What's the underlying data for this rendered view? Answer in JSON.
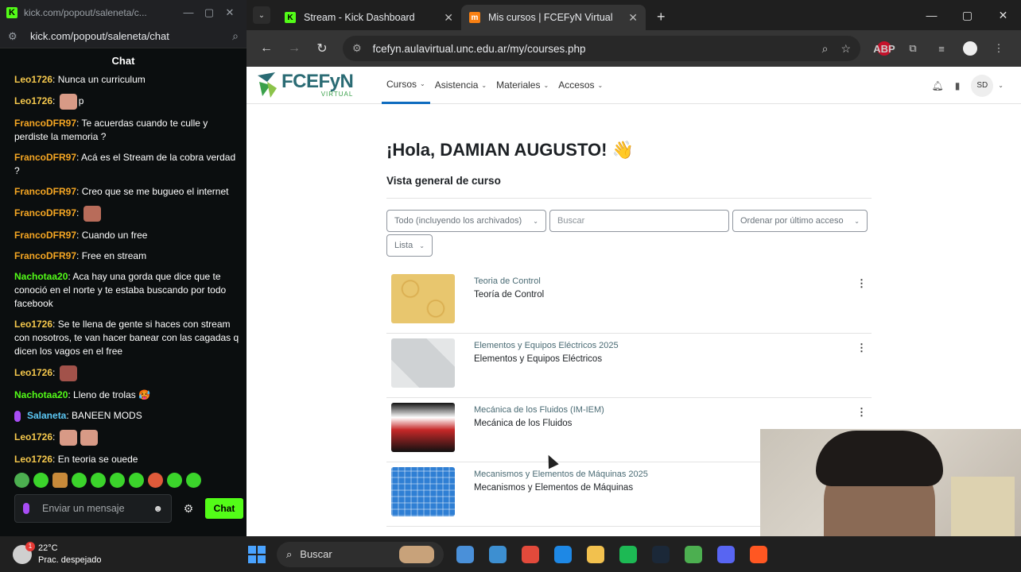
{
  "kick_window": {
    "title": "kick.com/popout/saleneta/c...",
    "url": "kick.com/popout/saleneta/chat",
    "chat_header": "Chat",
    "messages": [
      {
        "user": "Leo1726",
        "text": ": Nunca un curriculum",
        "color": "#f5c84c"
      },
      {
        "user": "Leo1726",
        "text": ": ",
        "tail": "p",
        "color": "#f5c84c",
        "emote": "#d89a86"
      },
      {
        "user": "FrancoDFR97",
        "text": ": Te acuerdas cuando te culle y perdiste la memoria ?",
        "color": "#f5a623"
      },
      {
        "user": "FrancoDFR97",
        "text": ": Acá es el Stream de la cobra verdad ?",
        "color": "#f5a623"
      },
      {
        "user": "FrancoDFR97",
        "text": ": Creo que se me bugueo el internet",
        "color": "#f5a623"
      },
      {
        "user": "FrancoDFR97",
        "text": ": ",
        "color": "#f5a623",
        "emote": "#b86c5a"
      },
      {
        "user": "FrancoDFR97",
        "text": ": Cuando un free",
        "color": "#f5a623"
      },
      {
        "user": "FrancoDFR97",
        "text": ": Free en stream",
        "color": "#f5a623"
      },
      {
        "user": "Nachotaa20",
        "text": ": Aca hay una gorda que dice que te conoció en el norte y te estaba buscando por todo facebook",
        "color": "#53fc18"
      },
      {
        "user": "Leo1726",
        "text": ": Se te llena de gente si haces con stream con nosotros, te van hacer banear con las cagadas q dicen los vagos en el free",
        "color": "#f5c84c"
      },
      {
        "user": "Leo1726",
        "text": ": ",
        "color": "#f5c84c",
        "emote": "#a2524a"
      },
      {
        "user": "Nachotaa20",
        "text": ": Lleno de trolas 🥵",
        "color": "#53fc18"
      },
      {
        "user": "Salaneta",
        "text": ": BANEEN MODS",
        "color": "#5cc8f5",
        "badge": true
      },
      {
        "user": "Leo1726",
        "text": ": ",
        "color": "#f5c84c",
        "emote": "#d89a86",
        "emote2": true
      },
      {
        "user": "Leo1726",
        "text": ": En teoria se ouede",
        "color": "#f5c84c"
      }
    ],
    "input_placeholder": "Enviar un mensaje",
    "chat_button": "Chat"
  },
  "browser": {
    "tabs": [
      {
        "label": "Stream - Kick Dashboard",
        "active": false,
        "fav": "K",
        "fav_color": "#53fc18"
      },
      {
        "label": "Mis cursos | FCEFyN Virtual",
        "active": true,
        "fav": "m",
        "fav_color": "#f98012"
      }
    ],
    "url": "fcefyn.aulavirtual.unc.edu.ar/my/courses.php",
    "abp": "ABP"
  },
  "moodle": {
    "brand_name": "FCEFyN",
    "brand_sub": "VIRTUAL",
    "menu": [
      {
        "label": "Cursos",
        "active": true
      },
      {
        "label": "Asistencia",
        "active": false
      },
      {
        "label": "Materiales",
        "active": false
      },
      {
        "label": "Accesos",
        "active": false
      }
    ],
    "avatar": "SD",
    "greeting": "¡Hola, DAMIAN AUGUSTO! 👋",
    "section_title": "Vista general de curso",
    "filter_grouping": "Todo (incluyendo los archivados)",
    "search_placeholder": "Buscar",
    "sort": "Ordenar por último acceso",
    "view": "Lista",
    "courses": [
      {
        "category": "Teoria de Control",
        "name": "Teoría de Control",
        "thumb": "#e8c66e"
      },
      {
        "category": "Elementos y Equipos Eléctricos 2025",
        "name": "Elementos y Equipos Eléctricos",
        "thumb": "#cfd2d4"
      },
      {
        "category": "Mecánica de los Fluidos (IM-IEM)",
        "name": "Mecánica de los Fluidos",
        "thumb": "#b7333a"
      },
      {
        "category": "Mecanismos y Elementos de Máquinas 2025",
        "name": "Mecanismos y Elementos de Máquinas",
        "thumb": "#2f7fd4"
      }
    ]
  },
  "taskbar": {
    "temp": "22°C",
    "weather": "Prac. despejado",
    "badge": "1",
    "search": "Buscar",
    "apps": [
      "#4a90d9",
      "#3d8fd1",
      "#e24a3b",
      "#1e88e5",
      "#f2c14e",
      "#1db954",
      "#1b2838",
      "#4caf50",
      "#5865f2",
      "#ff5722"
    ]
  }
}
